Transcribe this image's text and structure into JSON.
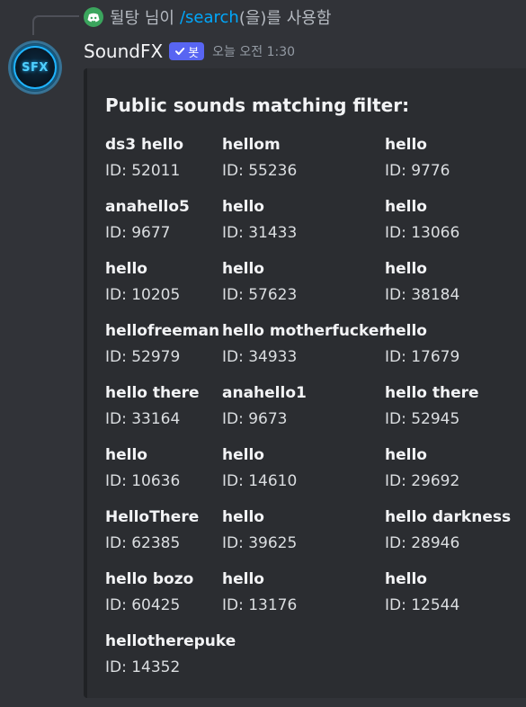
{
  "reply": {
    "user": "뒬탕 님이",
    "command": "/search",
    "suffix": "(을)를 사용함"
  },
  "author": {
    "avatar_text": "SFX",
    "username": "SoundFX",
    "bot_tag": "봇",
    "timestamp": "오늘 오전 1:30"
  },
  "embed": {
    "title": "Public sounds matching filter:",
    "fields": [
      {
        "name": "ds3 hello",
        "value": "ID: 52011"
      },
      {
        "name": "hellom",
        "value": "ID: 55236"
      },
      {
        "name": "hello",
        "value": "ID: 9776"
      },
      {
        "name": "anahello5",
        "value": "ID: 9677"
      },
      {
        "name": "hello",
        "value": "ID: 31433"
      },
      {
        "name": "hello",
        "value": "ID: 13066"
      },
      {
        "name": "hello",
        "value": "ID: 10205"
      },
      {
        "name": "hello",
        "value": "ID: 57623"
      },
      {
        "name": "hello",
        "value": "ID: 38184"
      },
      {
        "name": "hellofreeman",
        "value": "ID: 52979"
      },
      {
        "name": "hello motherfucker",
        "value": "ID: 34933"
      },
      {
        "name": "hello",
        "value": "ID: 17679"
      },
      {
        "name": "hello there",
        "value": "ID: 33164"
      },
      {
        "name": "anahello1",
        "value": "ID: 9673"
      },
      {
        "name": "hello there",
        "value": "ID: 52945"
      },
      {
        "name": "hello",
        "value": "ID: 10636"
      },
      {
        "name": "hello",
        "value": "ID: 14610"
      },
      {
        "name": "hello",
        "value": "ID: 29692"
      },
      {
        "name": "HelloThere",
        "value": "ID: 62385"
      },
      {
        "name": "hello",
        "value": "ID: 39625"
      },
      {
        "name": "hello darkness",
        "value": "ID: 28946"
      },
      {
        "name": "hello bozo",
        "value": "ID: 60425"
      },
      {
        "name": "hello",
        "value": "ID: 13176"
      },
      {
        "name": "hello",
        "value": "ID: 12544"
      },
      {
        "name": "hellotherepuke",
        "value": "ID: 14352"
      }
    ]
  },
  "colors": {
    "background": "#313338",
    "embed_background": "#2b2d31",
    "bot_tag": "#5865f2",
    "command_link": "#00a8fc"
  }
}
